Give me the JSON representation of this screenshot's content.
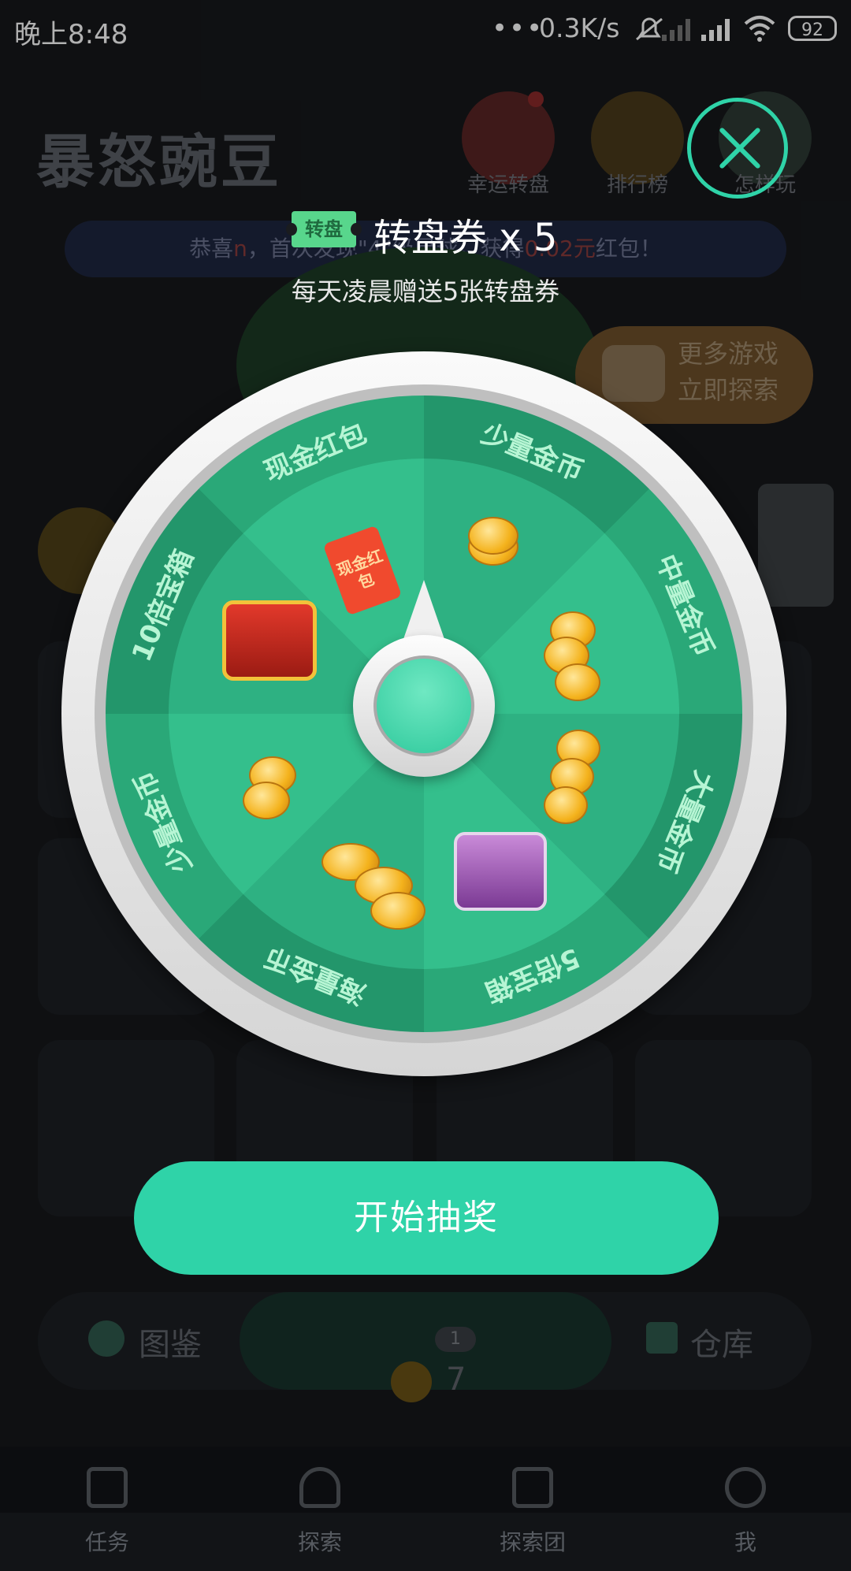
{
  "status_bar": {
    "time": "晚上8:48",
    "dots": "•••",
    "network_speed": "0.3K/s",
    "battery": "92"
  },
  "background_app": {
    "title": "暴怒豌豆",
    "top_icons": [
      {
        "label": "幸运转盘",
        "icon": "wheel-icon"
      },
      {
        "label": "排行榜",
        "icon": "trophy-icon"
      },
      {
        "label": "怎样玩",
        "icon": "book-icon"
      }
    ],
    "banner": {
      "prefix": "恭喜",
      "name": "n",
      "middle": "，首次发现\"4\"级星球，获得",
      "amount": "0.02元",
      "suffix": "红包！"
    },
    "more_games": {
      "line1": "更多游戏",
      "line2": "立即探索"
    },
    "bottom_bar": {
      "left_label": "图鉴",
      "right_label": "仓库",
      "center_count": "7",
      "center_badge": "1"
    },
    "nav": [
      "任务",
      "探索",
      "探索团",
      "我"
    ]
  },
  "dialog": {
    "ticket_badge": "转盘",
    "ticket_text": "转盘券 x 5",
    "subtitle": "每天凌晨赠送5张转盘券",
    "wheel_segments": [
      "少量金币",
      "中量金币",
      "大量金币",
      "5倍宝箱",
      "海量金币",
      "少量金币",
      "10倍宝箱",
      "现金红包"
    ],
    "envelope_text": "现金红包",
    "start_button": "开始抽奖"
  },
  "colors": {
    "accent": "#2fd3a8",
    "wheel_dark": "#23966b",
    "wheel_light": "#34bf8c"
  }
}
